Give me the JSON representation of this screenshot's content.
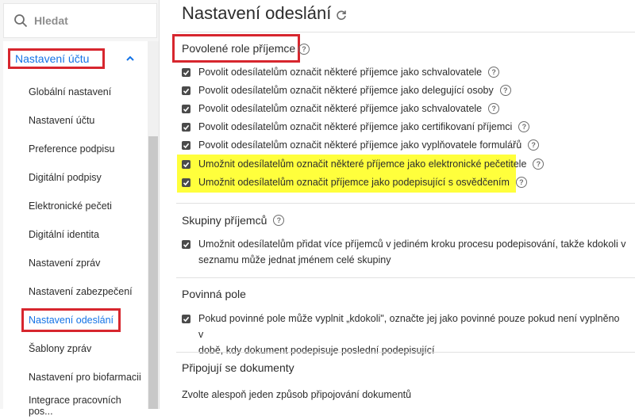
{
  "search": {
    "label": "Hledat"
  },
  "sidebar": {
    "section_label": "Nastavení účtu",
    "items": [
      {
        "label": "Globální nastavení",
        "active": false
      },
      {
        "label": "Nastavení účtu",
        "active": false
      },
      {
        "label": "Preference podpisu",
        "active": false
      },
      {
        "label": "Digitální podpisy",
        "active": false
      },
      {
        "label": "Elektronické pečeti",
        "active": false
      },
      {
        "label": "Digitální identita",
        "active": false
      },
      {
        "label": "Nastavení zpráv",
        "active": false
      },
      {
        "label": "Nastavení zabezpečení",
        "active": false
      },
      {
        "label": "Nastavení odeslání",
        "active": true
      },
      {
        "label": "Šablony zpráv",
        "active": false
      },
      {
        "label": "Nastavení pro biofarmacii",
        "active": false
      },
      {
        "label": "Integrace pracovních pos...",
        "active": false
      }
    ]
  },
  "main": {
    "title": "Nastavení odeslání",
    "sections": {
      "roles": {
        "title": "Povolené role příjemce",
        "items": [
          "Povolit odesílatelům označit některé příjemce jako schvalovatele",
          "Povolit odesílatelům označit některé příjemce jako delegující osoby",
          "Povolit odesílatelům označit některé příjemce jako schvalovatele",
          "Povolit odesílatelům označit některé příjemce jako certifikovaní příjemci",
          "Povolit odesílatelům označit některé příjemce jako vyplňovatele formulářů",
          "Umožnit odesílatelům označit některé příjemce jako elektronické pečetitele",
          "Umožnit odesílatelům označit příjemce jako podepisující s osvědčením"
        ]
      },
      "groups": {
        "title": "Skupiny příjemců",
        "item_line1": "Umožnit odesílatelům přidat více příjemců v jediném kroku procesu podepisování, takže kdokoli v",
        "item_line2": "seznamu může jednat jménem celé skupiny"
      },
      "required": {
        "title": "Povinná pole",
        "item_line1": "Pokud povinné pole může vyplnit „kdokoli\", označte jej jako povinné pouze pokud není vyplněno v",
        "item_line2": "době, kdy dokument podepisuje poslední podepisující"
      },
      "attach": {
        "title": "Připojují se dokumenty",
        "text": "Zvolte alespoň jeden způsob připojování dokumentů"
      }
    },
    "help_glyph": "?"
  },
  "colors": {
    "accent": "#1473e6",
    "annotation_red": "#d7262e",
    "highlight_yellow": "#ffff3c"
  }
}
